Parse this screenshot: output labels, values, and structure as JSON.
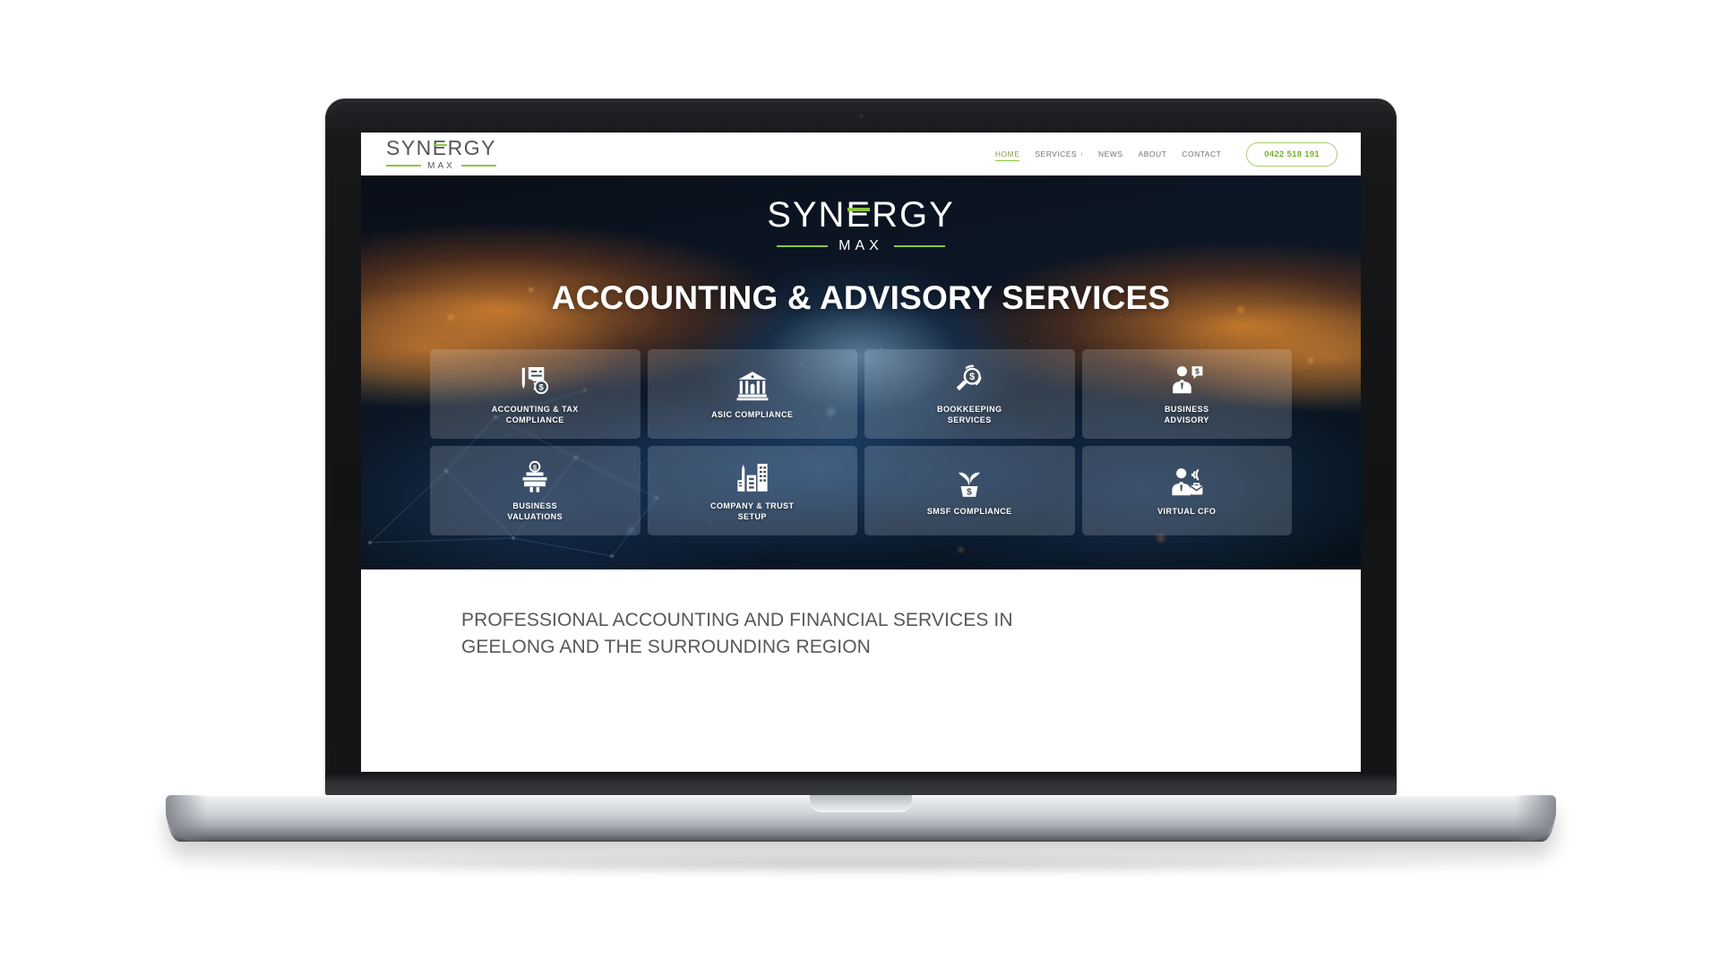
{
  "site": {
    "brand_word": "SYNERGY",
    "brand_sub": "MAX",
    "accent_green": "#8cc63f",
    "text_gray": "#54575a"
  },
  "header": {
    "nav": [
      {
        "label": "HOME",
        "active": true,
        "caret": ""
      },
      {
        "label": "SERVICES",
        "active": false,
        "caret": "›"
      },
      {
        "label": "NEWS",
        "active": false,
        "caret": ""
      },
      {
        "label": "ABOUT",
        "active": false,
        "caret": ""
      },
      {
        "label": "CONTACT",
        "active": false,
        "caret": ""
      }
    ],
    "phone_button": "0422 518 191"
  },
  "hero": {
    "brand_word": "SYNERGY",
    "brand_sub": "MAX",
    "title": "ACCOUNTING & ADVISORY SERVICES"
  },
  "services": [
    {
      "label": "ACCOUNTING & TAX\nCOMPLIANCE",
      "icon": "invoice-dollar-icon"
    },
    {
      "label": "ASIC COMPLIANCE",
      "icon": "bank-building-icon"
    },
    {
      "label": "BOOKKEEPING\nSERVICES",
      "icon": "magnifier-dollar-icon"
    },
    {
      "label": "BUSINESS\nADVISORY",
      "icon": "advisor-speech-dollar-icon"
    },
    {
      "label": "BUSINESS\nVALUATIONS",
      "icon": "valuation-stand-dollar-icon"
    },
    {
      "label": "COMPANY & TRUST\nSETUP",
      "icon": "city-buildings-icon"
    },
    {
      "label": "SMSF COMPLIANCE",
      "icon": "plant-pot-dollar-icon"
    },
    {
      "label": "VIRTUAL CFO",
      "icon": "cfo-wifi-briefcase-icon"
    }
  ],
  "tagline": {
    "text": "PROFESSIONAL ACCOUNTING AND FINANCIAL SERVICES IN GEELONG AND THE SURROUNDING REGION"
  }
}
